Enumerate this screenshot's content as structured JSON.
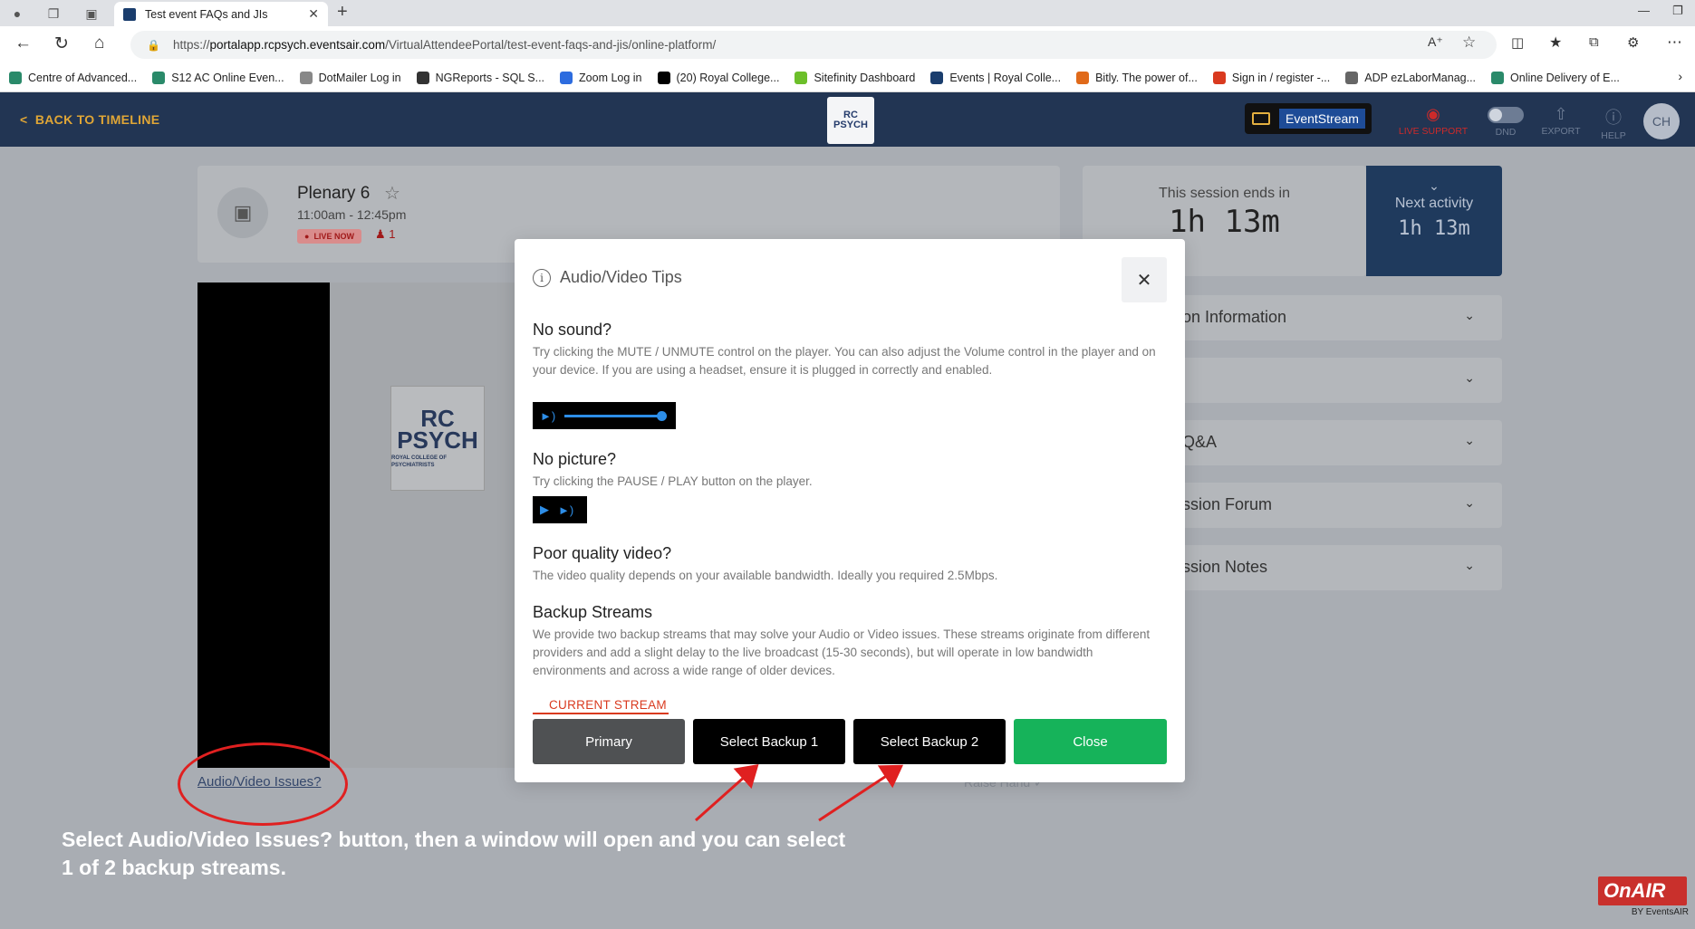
{
  "browser": {
    "tab_title": "Test event FAQs and JIs",
    "url_prefix": "https://",
    "url_host": "portalapp.rcpsych.eventsair.com",
    "url_path": "/VirtualAttendeePortal/test-event-faqs-and-jis/online-platform/",
    "bookmarks": [
      {
        "label": "Centre of Advanced...",
        "color": "#2a8a6a"
      },
      {
        "label": "S12 AC Online Even...",
        "color": "#2a8a6a"
      },
      {
        "label": "DotMailer Log in",
        "color": "#888888"
      },
      {
        "label": "NGReports - SQL S...",
        "color": "#333333"
      },
      {
        "label": "Zoom Log in",
        "color": "#2d6cdf"
      },
      {
        "label": "(20) Royal College...",
        "color": "#000000"
      },
      {
        "label": "Sitefinity Dashboard",
        "color": "#6cbf2a"
      },
      {
        "label": "Events | Royal Colle...",
        "color": "#1a3d6d"
      },
      {
        "label": "Bitly. The power of...",
        "color": "#e06a1a"
      },
      {
        "label": "Sign in / register -...",
        "color": "#d93a1f"
      },
      {
        "label": "ADP ezLaborManag...",
        "color": "#666666"
      },
      {
        "label": "Online Delivery of E...",
        "color": "#2a8a6a"
      }
    ]
  },
  "header": {
    "back_label": "BACK TO TIMELINE",
    "logo_line1": "RC",
    "logo_line2": "PSYCH",
    "eventstream_label": "EventStream",
    "live_support": "LIVE SUPPORT",
    "dnd": "DND",
    "export": "EXPORT",
    "help": "HELP",
    "avatar_initials": "CH"
  },
  "session": {
    "title": "Plenary 6",
    "time": "11:00am - 12:45pm",
    "live_badge": "LIVE NOW",
    "viewer_count": "1",
    "ends_label": "This session ends in",
    "ends_value": "1h 13m",
    "next_label": "Next activity",
    "next_value": "1h 13m"
  },
  "accordion": [
    {
      "label": "on Information"
    },
    {
      "label": ""
    },
    {
      "label": "Q&A"
    },
    {
      "label": "ssion Forum"
    },
    {
      "label": "ssion Notes"
    }
  ],
  "slide": {
    "line1": "RC",
    "line2": "PSYCH",
    "line3": "ROYAL COLLEGE OF PSYCHIATRISTS"
  },
  "av_link": "Audio/Video Issues?",
  "raise_hand": "Raise Hand",
  "modal": {
    "title": "Audio/Video Tips",
    "sections": [
      {
        "heading": "No sound?",
        "text": "Try clicking the MUTE / UNMUTE control on the player. You can also adjust the Volume control in the player and on your device. If you are using a headset, ensure it is plugged in correctly and enabled."
      },
      {
        "heading": "No picture?",
        "text": "Try clicking the PAUSE / PLAY button on the player."
      },
      {
        "heading": "Poor quality video?",
        "text": "The video quality depends on your available bandwidth. Ideally you required 2.5Mbps."
      },
      {
        "heading": "Backup Streams",
        "text": "We provide two backup streams that may solve your Audio or Video issues. These streams originate from different providers and add a slight delay to the live broadcast (15-30 seconds), but will operate in low bandwidth environments and across a wide range of older devices."
      }
    ],
    "current_stream_label": "CURRENT STREAM",
    "buttons": {
      "primary": "Primary",
      "backup1": "Select Backup 1",
      "backup2": "Select Backup 2",
      "close": "Close"
    }
  },
  "annotation": {
    "line1": "Select Audio/Video Issues? button, then a window will open and you can select",
    "line2": "1 of 2 backup streams."
  },
  "branding": {
    "onair": "OnAIR",
    "by": "BY EventsAIR"
  }
}
